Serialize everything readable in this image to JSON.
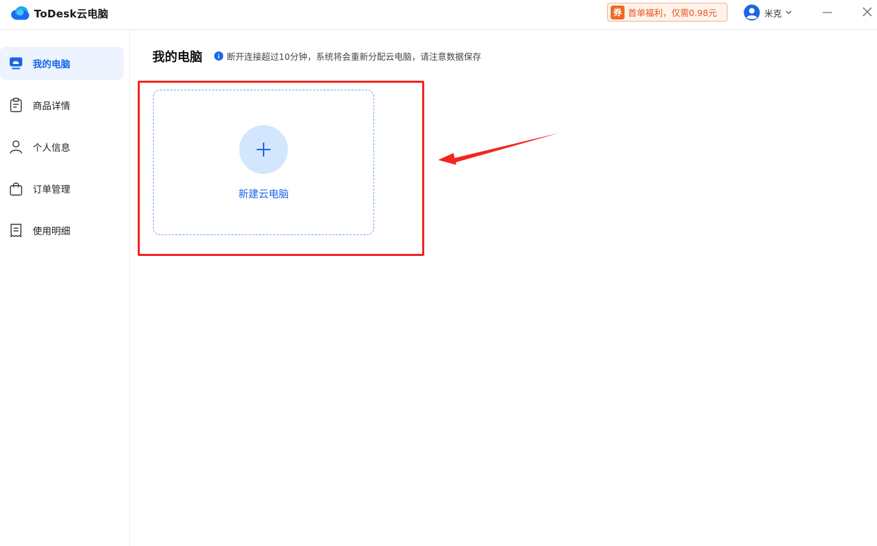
{
  "app": {
    "title": "ToDesk云电脑"
  },
  "titlebar": {
    "promo_badge": "券",
    "promo_text": "首单福利，仅需0.98元",
    "user_name": "米克"
  },
  "sidebar": {
    "items": [
      {
        "label": "我的电脑",
        "icon": "monitor-cloud-icon",
        "active": true
      },
      {
        "label": "商品详情",
        "icon": "clipboard-icon",
        "active": false
      },
      {
        "label": "个人信息",
        "icon": "person-icon",
        "active": false
      },
      {
        "label": "订单管理",
        "icon": "shopping-bag-icon",
        "active": false
      },
      {
        "label": "使用明细",
        "icon": "receipt-icon",
        "active": false
      }
    ]
  },
  "main": {
    "title": "我的电脑",
    "notice": "断开连接超过10分钟，系统将会重新分配云电脑，请注意数据保存",
    "new_pc_label": "新建云电脑"
  },
  "colors": {
    "accent": "#1a66e6",
    "active_bg": "#edf4ff",
    "promo": "#e8541c",
    "annotation_red": "#f2251f"
  }
}
